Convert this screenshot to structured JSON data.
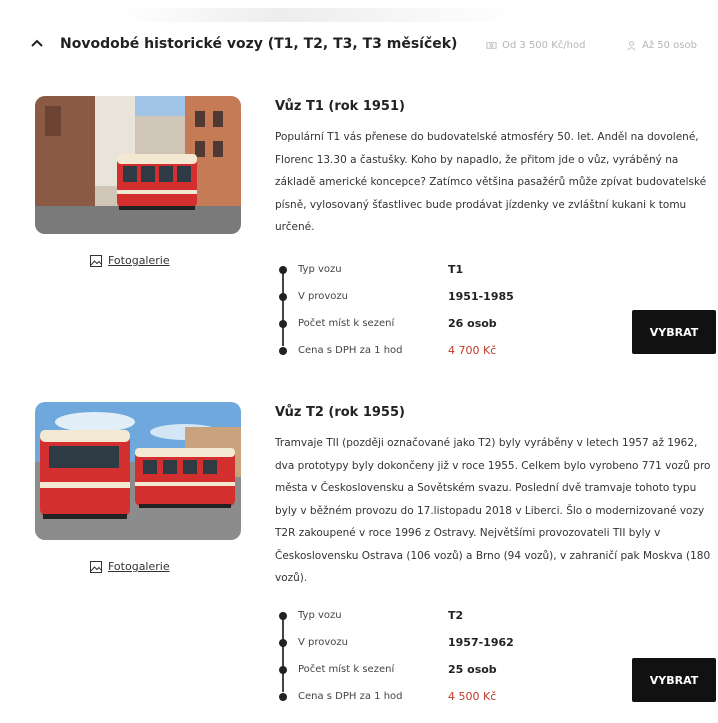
{
  "section": {
    "title": "Novodobé historické vozy (T1, T2, T3, T3 měsíček)",
    "meta_price": "Od 3 500 Kč/hod",
    "meta_people": "Až 50 osob",
    "toggle_icon": "chevron-up-icon"
  },
  "cars": [
    {
      "title": "Vůz T1 (rok 1951)",
      "description": "Populární T1 vás přenese do budovatelské atmosféry 50. let. Anděl na dovolené, Florenc 13.30 a častušky. Koho by napadlo, že přitom jde o vůz, vyráběný na základě americké koncepce? Zatímco většina pasažérů může zpívat budovatelské písně, vylosovaný šťastlivec bude prodávat jízdenky ve zvláštní kukani k tomu určené.",
      "gallery_label": "Fotogalerie",
      "specs": [
        {
          "label": "Typ vozu",
          "value": "T1"
        },
        {
          "label": "V provozu",
          "value": "1951-1985"
        },
        {
          "label": "Počet míst k sezení",
          "value": "26 osob"
        },
        {
          "label": "Cena s DPH za 1 hod",
          "value": "4 700 Kč"
        }
      ],
      "button_label": "VYBRAT"
    },
    {
      "title": "Vůz T2 (rok 1955)",
      "description": "Tramvaje TII (později označované jako T2) byly vyráběny v letech 1957 až 1962, dva prototypy byly dokončeny již v roce 1955. Celkem bylo vyrobeno 771 vozů pro města v Československu a Sovětském svazu. Poslední dvě tramvaje tohoto typu byly v běžném provozu do 17.listopadu 2018 v Liberci. Šlo o modernizované vozy T2R zakoupené v roce 1996 z Ostravy. Největšími provozovateli TII byly v Československu Ostrava (106 vozů) a Brno (94 vozů), v zahraničí pak Moskva (180 vozů).",
      "gallery_label": "Fotogalerie",
      "specs": [
        {
          "label": "Typ vozu",
          "value": "T2"
        },
        {
          "label": "V provozu",
          "value": "1957-1962"
        },
        {
          "label": "Počet míst k sezení",
          "value": "25 osob"
        },
        {
          "label": "Cena s DPH za 1 hod",
          "value": "4 500 Kč"
        }
      ],
      "button_label": "VYBRAT"
    }
  ],
  "colors": {
    "price": "#c0392b",
    "button_bg": "#111111",
    "tram_red": "#d32f2f",
    "tram_cream": "#f3e9d2"
  }
}
